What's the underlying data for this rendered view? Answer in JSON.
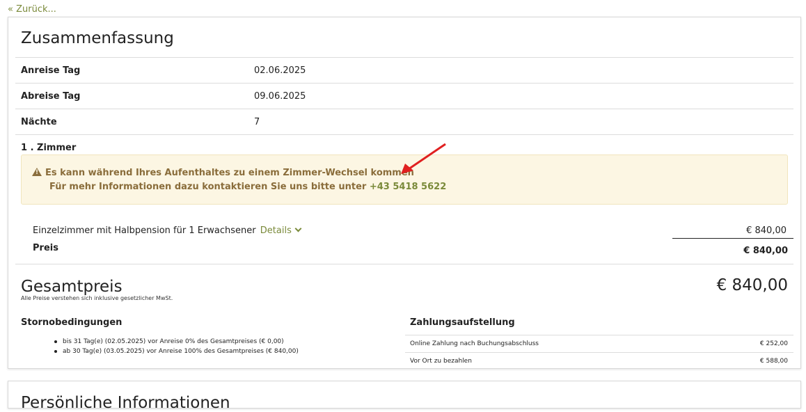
{
  "nav": {
    "back_label": "« Zurück..."
  },
  "summary": {
    "title": "Zusammenfassung",
    "rows": [
      {
        "label": "Anreise Tag",
        "value": "02.06.2025"
      },
      {
        "label": "Abreise Tag",
        "value": "09.06.2025"
      },
      {
        "label": "Nächte",
        "value": "7"
      }
    ]
  },
  "room": {
    "title": "1 . Zimmer",
    "alert": {
      "icon": "warning-triangle-icon",
      "line1": "Es kann während Ihres Aufenthaltes zu einem Zimmer-Wechsel kommen",
      "line2_prefix": "Für mehr Informationen dazu kontaktieren Sie uns bitte unter",
      "phone": "+43 5418 5622"
    },
    "item_description": "Einzelzimmer mit Halbpension für 1 Erwachsener",
    "details_label": "Details",
    "item_price": "€ 840,00",
    "price_label": "Preis",
    "price_value": "€ 840,00"
  },
  "total": {
    "label": "Gesamtpreis",
    "note": "Alle Preise verstehen sich inklusive gesetzlicher MwSt.",
    "value": "€ 840,00"
  },
  "cancellation": {
    "title": "Stornobedingungen",
    "items": [
      "bis 31 Tag(e) (02.05.2025) vor Anreise 0% des Gesamtpreises (€ 0,00)",
      "ab 30 Tag(e) (03.05.2025) vor Anreise 100% des Gesamtpreises (€ 840,00)"
    ]
  },
  "payment": {
    "title": "Zahlungsaufstellung",
    "rows": [
      {
        "label": "Online Zahlung nach Buchungsabschluss",
        "value": "€ 252,00"
      },
      {
        "label": "Vor Ort zu bezahlen",
        "value": "€ 588,00"
      }
    ]
  },
  "next_section": {
    "title": "Persönliche Informationen"
  },
  "colors": {
    "accent": "#7a8a3a",
    "alert_bg": "#fcf6e3",
    "alert_text": "#8a6d3b",
    "annotation_arrow": "#e02020"
  }
}
